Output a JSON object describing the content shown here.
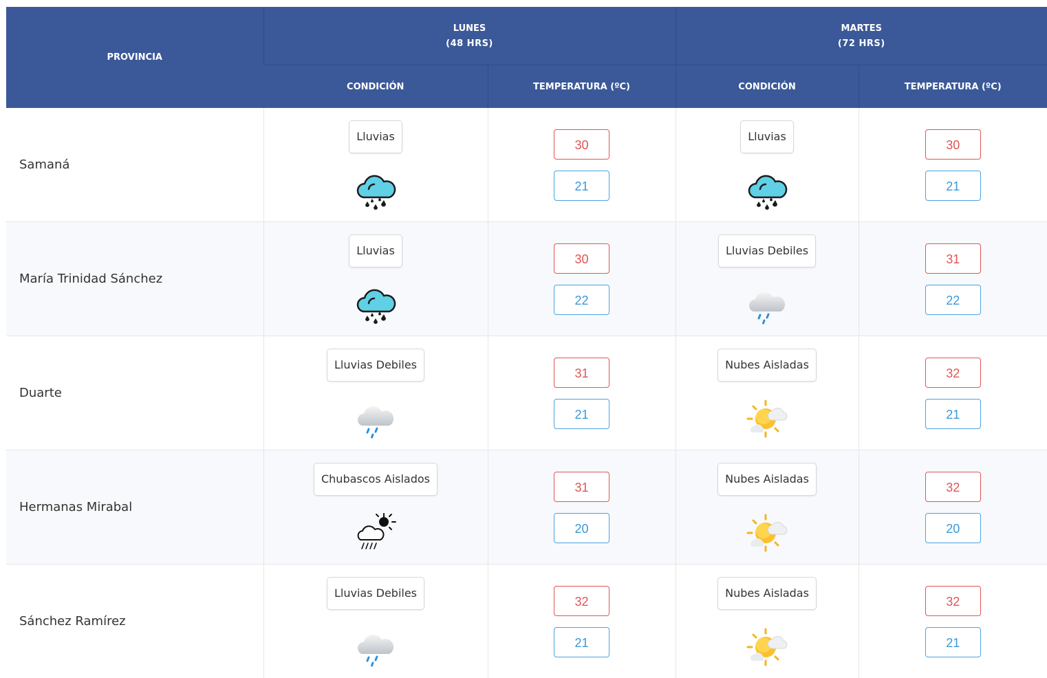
{
  "header": {
    "province": "PROVINCIA",
    "day1": {
      "name": "LUNES",
      "sub": "(48 HRS)"
    },
    "day2": {
      "name": "MARTES",
      "sub": "(72 HRS)"
    },
    "condition": "CONDICIÓN",
    "temperature": "TEMPERATURA (ºC)"
  },
  "colors": {
    "header_bg": "#3b5998",
    "max_temp": "#e15454",
    "min_temp": "#3a98d8"
  },
  "rows": [
    {
      "province": "Samaná",
      "d1": {
        "condition": "Lluvias",
        "icon": "rain-cloud-icon",
        "max": "30",
        "min": "21"
      },
      "d2": {
        "condition": "Lluvias",
        "icon": "rain-cloud-icon",
        "max": "30",
        "min": "21"
      }
    },
    {
      "province": "María Trinidad Sánchez",
      "d1": {
        "condition": "Lluvias",
        "icon": "rain-cloud-icon",
        "max": "30",
        "min": "22"
      },
      "d2": {
        "condition": "Lluvias Debiles",
        "icon": "light-rain-icon",
        "max": "31",
        "min": "22"
      }
    },
    {
      "province": "Duarte",
      "d1": {
        "condition": "Lluvias Debiles",
        "icon": "light-rain-icon",
        "max": "31",
        "min": "21"
      },
      "d2": {
        "condition": "Nubes Aisladas",
        "icon": "sun-cloud-icon",
        "max": "32",
        "min": "21"
      }
    },
    {
      "province": "Hermanas Mirabal",
      "d1": {
        "condition": "Chubascos Aislados",
        "icon": "sun-shower-icon",
        "max": "31",
        "min": "20"
      },
      "d2": {
        "condition": "Nubes Aisladas",
        "icon": "sun-cloud-icon",
        "max": "32",
        "min": "20"
      }
    },
    {
      "province": "Sánchez Ramírez",
      "d1": {
        "condition": "Lluvias Debiles",
        "icon": "light-rain-icon",
        "max": "32",
        "min": "21"
      },
      "d2": {
        "condition": "Nubes Aisladas",
        "icon": "sun-cloud-icon",
        "max": "32",
        "min": "21"
      }
    }
  ]
}
